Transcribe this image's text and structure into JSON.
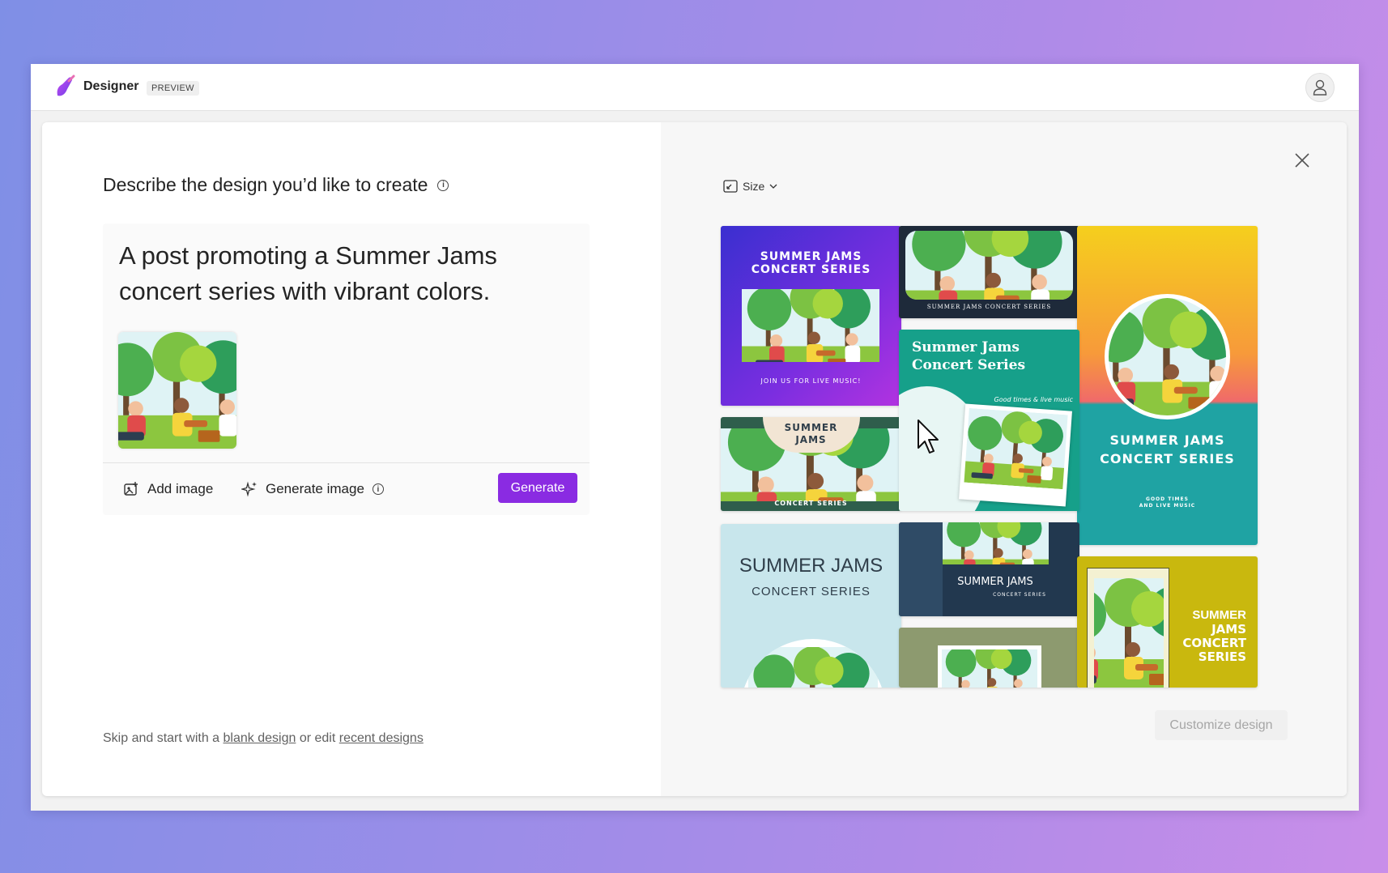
{
  "app": {
    "title": "Designer",
    "badge": "PREVIEW"
  },
  "left": {
    "heading": "Describe the design you’d like to create",
    "prompt": "A post promoting a Summer Jams concert series with vibrant colors.",
    "add_image_label": "Add image",
    "generate_image_label": "Generate image",
    "generate_button": "Generate",
    "skip": {
      "prefix": "Skip and start with a",
      "blank_link": "blank design",
      "middle": "or edit",
      "recent_link": "recent designs"
    }
  },
  "right": {
    "size_label": "Size",
    "customize_button": "Customize design",
    "designs": [
      {
        "line1": "SUMMER JAMS",
        "line2": "CONCERT SERIES",
        "footer": "JOIN US FOR LIVE MUSIC!"
      },
      {
        "footer": "SUMMER JAMS CONCERT SERIES"
      },
      {
        "line1": "SUMMER JAMS",
        "line2": "CONCERT SERIES",
        "sub1": "GOOD TIMES",
        "sub2": "AND LIVE MUSIC"
      },
      {
        "line1": "SUMMER",
        "line2": "JAMS",
        "footer": "CONCERT SERIES"
      },
      {
        "line1": "Summer Jams",
        "line2": "Concert Series",
        "sub": "Good times & live music"
      },
      {
        "line1": "SUMMER JAMS",
        "line2": "CONCERT SERIES"
      },
      {
        "line1": "SUMMER JAMS",
        "sub": "CONCERT SERIES"
      },
      {},
      {
        "line1": "SUMMER",
        "line2": "JAMS",
        "line3": "CONCERT",
        "line4": "SERIES"
      }
    ]
  },
  "colors": {
    "accent": "#8a2be2",
    "background_start": "#7f8fe6",
    "background_end": "#c98ee9"
  },
  "icons": [
    "designer-logo-icon",
    "user-icon",
    "info-icon",
    "add-image-icon",
    "sparkle-icon",
    "resize-icon",
    "chevron-down-icon",
    "close-icon",
    "cursor-icon"
  ]
}
